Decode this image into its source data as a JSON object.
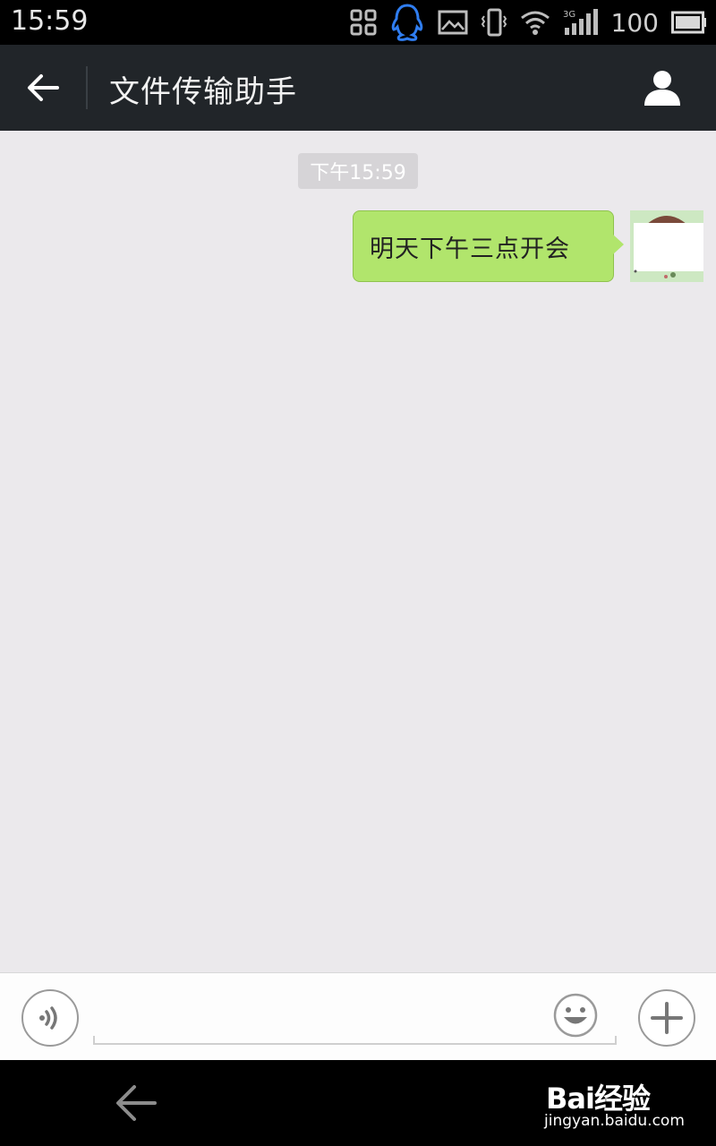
{
  "status_bar": {
    "time": "15:59",
    "network": "3G",
    "battery": "100",
    "icons": [
      "scan-icon",
      "qq-penguin-icon",
      "image-icon",
      "vibrate-icon",
      "wifi-icon",
      "signal-icon",
      "battery-icon"
    ]
  },
  "header": {
    "title": "文件传输助手",
    "back_icon": "arrow-left-icon",
    "contact_icon": "person-icon",
    "bg_color": "#212529"
  },
  "chat": {
    "timestamp": "下午15:59",
    "messages": [
      {
        "sender": "me",
        "text": "明天下午三点开会",
        "bubble_color": "#b1e56c"
      }
    ]
  },
  "input_bar": {
    "voice_icon": "voice-icon",
    "input_value": "",
    "emoji_icon": "smiley-icon",
    "more_icon": "plus-icon"
  },
  "nav_bar": {
    "back_icon": "arrow-left-icon"
  },
  "watermark": {
    "brand": "Bai经验",
    "url": "jingyan.baidu.com"
  }
}
